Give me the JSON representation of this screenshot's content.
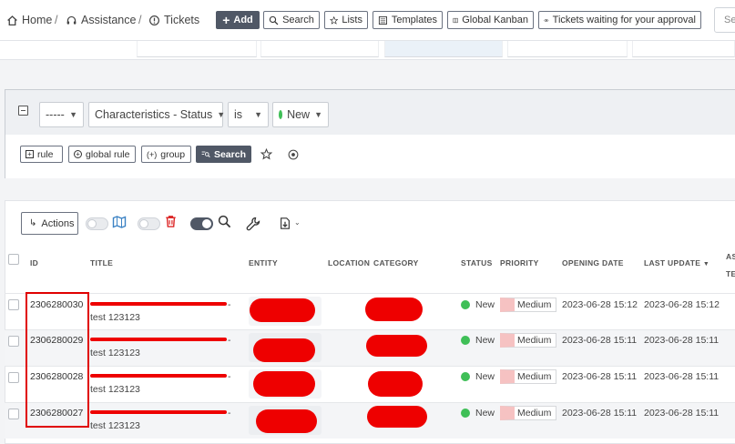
{
  "breadcrumb": {
    "home": "Home",
    "assistance": "Assistance",
    "tickets": "Tickets",
    "separator": "/"
  },
  "toolbar": {
    "add": "Add",
    "search": "Search",
    "lists": "Lists",
    "templates": "Templates",
    "kanban": "Global Kanban",
    "approval": "Tickets waiting for your approval"
  },
  "search_box": {
    "placeholder": "Se"
  },
  "filter": {
    "link_select": "-----",
    "field_select": "Characteristics - Status",
    "operator_select": "is",
    "value_select": "New",
    "value_color": "#3fbf57",
    "buttons": {
      "rule": "rule",
      "global_rule": "global rule",
      "group": "group",
      "search": "Search"
    }
  },
  "actions": {
    "label": "Actions"
  },
  "table": {
    "headers": {
      "id": "ID",
      "title": "TITLE",
      "entity": "ENTITY",
      "location": "LOCATION",
      "category": "CATEGORY",
      "status": "STATUS",
      "priority": "PRIORITY",
      "opening_date": "OPENING DATE",
      "last_update": "LAST UPDATE",
      "extra1": "AS",
      "extra2": "TE"
    },
    "rows": [
      {
        "id": "2306280030",
        "title_end": "-",
        "title_line2": "test 123123",
        "status": "New",
        "priority": "Medium",
        "opening": "2023-06-28 15:12",
        "updated": "2023-06-28 15:12"
      },
      {
        "id": "2306280029",
        "title_end": "-",
        "title_line2": "test 123123",
        "status": "New",
        "priority": "Medium",
        "opening": "2023-06-28 15:11",
        "updated": "2023-06-28 15:11"
      },
      {
        "id": "2306280028",
        "title_end": "-",
        "title_line2": "test 123123",
        "status": "New",
        "priority": "Medium",
        "opening": "2023-06-28 15:11",
        "updated": "2023-06-28 15:11"
      },
      {
        "id": "2306280027",
        "title_end": "-",
        "title_line2": "test 123123",
        "status": "New",
        "priority": "Medium",
        "opening": "2023-06-28 15:11",
        "updated": "2023-06-28 15:11"
      }
    ]
  },
  "colors": {
    "status_new": "#3fbf57",
    "priority_medium": "#f6c2c2",
    "redaction": "#ee0000",
    "dark_button": "#505866"
  }
}
